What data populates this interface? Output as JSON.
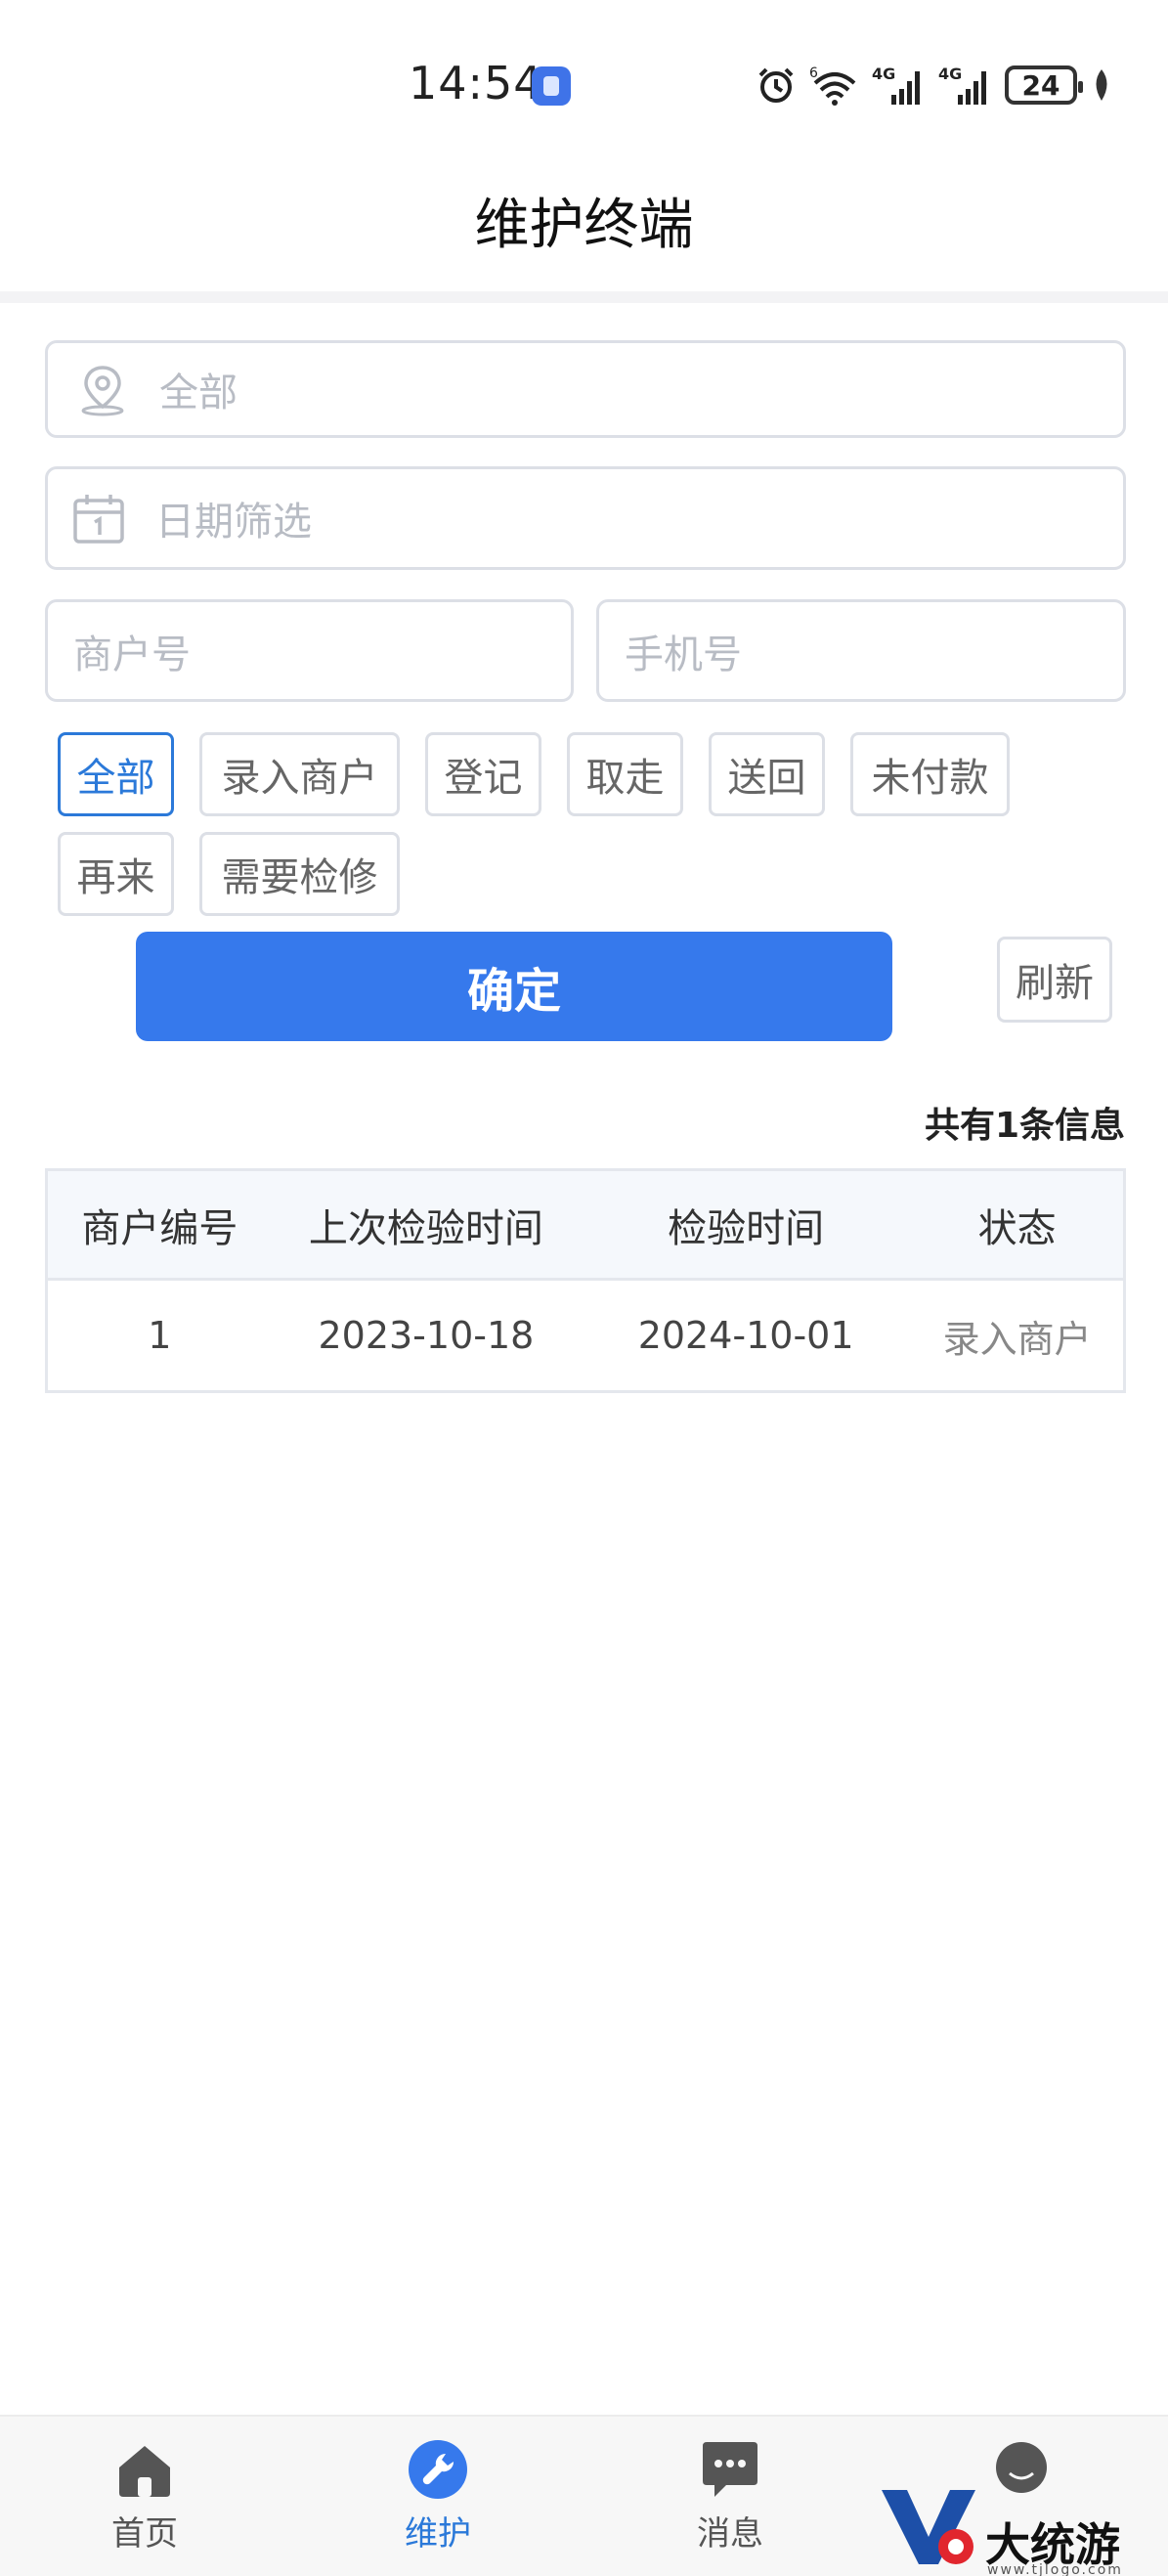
{
  "status_bar": {
    "time": "14:54",
    "battery_level": "24",
    "icons": [
      "app-badge-icon",
      "alarm-icon",
      "wifi-icon",
      "signal-4g-icon",
      "signal-4g-icon",
      "battery-icon",
      "leaf-icon"
    ],
    "network_labels": [
      "4G",
      "4G"
    ],
    "wifi_sup": "6"
  },
  "header": {
    "title": "维护终端"
  },
  "filters": {
    "region_placeholder": "全部",
    "date_placeholder": "日期筛选",
    "merchant_placeholder": "商户号",
    "phone_placeholder": "手机号",
    "chips": [
      {
        "label": "全部",
        "active": true
      },
      {
        "label": "录入商户",
        "active": false
      },
      {
        "label": "登记",
        "active": false
      },
      {
        "label": "取走",
        "active": false
      },
      {
        "label": "送回",
        "active": false
      },
      {
        "label": "未付款",
        "active": false
      },
      {
        "label": "再来",
        "active": false
      },
      {
        "label": "需要检修",
        "active": false
      }
    ]
  },
  "actions": {
    "confirm_label": "确定",
    "refresh_label": "刷新"
  },
  "results": {
    "count_text": "共有1条信息",
    "columns": [
      "商户编号",
      "上次检验时间",
      "检验时间",
      "状态"
    ],
    "rows": [
      [
        "1",
        "2023-10-18",
        "2024-10-01",
        "录入商户"
      ]
    ]
  },
  "bottom_nav": {
    "items": [
      {
        "label": "首页",
        "icon": "home-icon",
        "active": false
      },
      {
        "label": "维护",
        "icon": "wrench-icon",
        "active": true
      },
      {
        "label": "消息",
        "icon": "message-icon",
        "active": false
      },
      {
        "label": "",
        "icon": "user-icon",
        "active": false
      }
    ]
  },
  "watermark": {
    "text": "大统游戏园",
    "sub": "www.tjlogo.com"
  },
  "colors": {
    "accent": "#3679ec",
    "chip_active": "#2b79d9",
    "border": "#dcdfe6",
    "placeholder": "#b8bcc4"
  }
}
